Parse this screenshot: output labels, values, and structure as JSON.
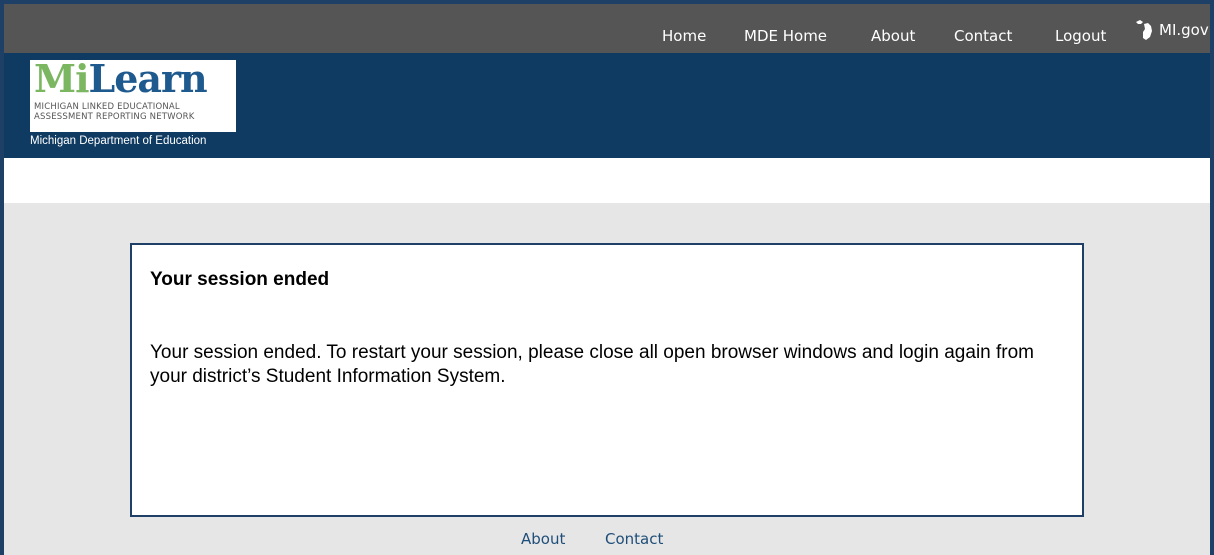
{
  "nav": {
    "home": "Home",
    "mde_home": "MDE Home",
    "about": "About",
    "contact": "Contact",
    "logout": "Logout",
    "mi_gov": "MI.gov"
  },
  "logo": {
    "word_mi": "Mi",
    "word_learn": "Learn",
    "subtitle_line1": "MICHIGAN LINKED EDUCATIONAL",
    "subtitle_line2": "ASSESSMENT REPORTING NETWORK",
    "department": "Michigan Department of Education"
  },
  "card": {
    "title": "Your session ended",
    "body": "Your session ended. To restart your session, please close all open browser windows and login again from your district’s Student Information System."
  },
  "footer": {
    "about": "About",
    "contact": "Contact"
  },
  "colors": {
    "top_nav_bg": "#555555",
    "header_bg": "#0f3b63",
    "main_bg": "#e6e6e6",
    "card_border": "#1e3f66",
    "footer_link": "#1f4e79",
    "logo_green": "#7bb661",
    "logo_blue": "#1e5a8e"
  },
  "icons": {
    "mi_gov": "michigan-state-icon"
  }
}
